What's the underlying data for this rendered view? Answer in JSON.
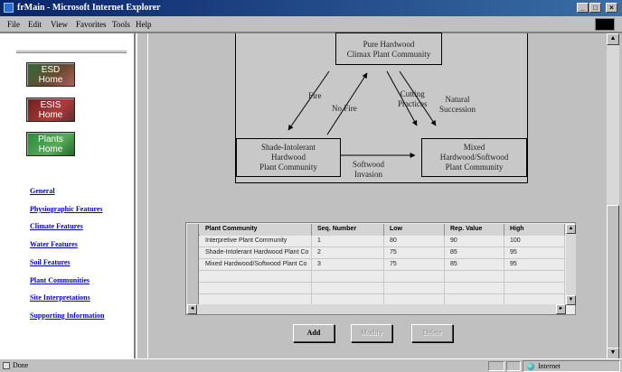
{
  "window": {
    "title": "frMain - Microsoft Internet Explorer",
    "min_glyph": "_",
    "max_glyph": "□",
    "close_glyph": "×"
  },
  "menubar": {
    "items": [
      "File",
      "Edit",
      "View",
      "Favorites",
      "Tools",
      "Help"
    ]
  },
  "sidebar": {
    "home_buttons": [
      {
        "label_1": "ESD",
        "label_2": "Home"
      },
      {
        "label_1": "ESIS",
        "label_2": "Home"
      },
      {
        "label_1": "Plants",
        "label_2": "Home"
      }
    ],
    "links": [
      "General",
      "Physiographic Features",
      "Climate Features",
      "Water Features",
      "Soil Features",
      "Plant Communities",
      "Site Interpretations",
      "Supporting Information"
    ]
  },
  "diagram": {
    "top_box": {
      "line1": "Pure Hardwood",
      "line2": "Climax Plant Community"
    },
    "left_box": {
      "line1": "Shade-Intolerant",
      "line2": "Hardwood",
      "line3": "Plant Community"
    },
    "right_box": {
      "line1": "Mixed",
      "line2": "Hardwood/Softwood",
      "line3": "Plant Community"
    },
    "labels": {
      "fire": "Fire",
      "no_fire": "No Fire",
      "cutting_1": "Cutting",
      "cutting_2": "Practices",
      "natural_1": "Natural",
      "natural_2": "Succession",
      "softwood_1": "Softwood",
      "softwood_2": "Invasion"
    }
  },
  "grid": {
    "columns": [
      "Plant Community",
      "Seq. Number",
      "Low",
      "Rep. Value",
      "High"
    ],
    "rows": [
      [
        "Interpretive Plant Community",
        "1",
        "80",
        "90",
        "100"
      ],
      [
        "Shade-Intolerant Hardwood Plant Co",
        "2",
        "75",
        "85",
        "95"
      ],
      [
        "Mixed Hardwood/Softwood Plant Co",
        "3",
        "75",
        "85",
        "95"
      ],
      [
        "",
        "",
        "",
        "",
        ""
      ],
      [
        "",
        "",
        "",
        "",
        ""
      ],
      [
        "",
        "",
        "",
        "",
        ""
      ]
    ]
  },
  "actions": {
    "add": "Add",
    "modify": "Modify",
    "delete": "Delete"
  },
  "statusbar": {
    "status": "Done",
    "zone": "Internet"
  }
}
